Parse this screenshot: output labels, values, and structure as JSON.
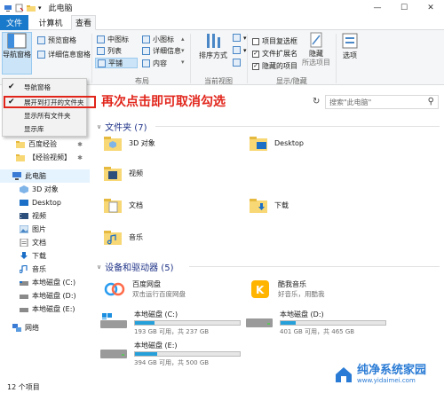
{
  "window": {
    "title": "此电脑"
  },
  "tabs": {
    "file": "文件",
    "computer": "计算机",
    "view": "查看"
  },
  "ribbon": {
    "nav_pane_button": "导航窗格",
    "preview_pane": "预览窗格",
    "details_pane": "详细信息窗格",
    "layout": {
      "medium_icons": "中图标",
      "small_icons": "小图标",
      "list": "列表",
      "details": "详细信息",
      "tiles": "平铺",
      "content": "内容"
    },
    "sort_by": "排序方式",
    "item_checkboxes": "项目复选框",
    "file_extensions": "文件扩展名",
    "hidden_items": "隐藏的项目",
    "hide_selected": "隐藏",
    "hide_selected_sub": "所选项目",
    "options": "选项",
    "groups": {
      "layout": "布局",
      "current_view": "当前视图",
      "show_hide": "显示/隐藏"
    }
  },
  "search": {
    "placeholder": "搜索\"此电脑\""
  },
  "dropdown": {
    "items": [
      {
        "label": "导航窗格",
        "checked": true
      },
      {
        "label": "展开到打开的文件夹",
        "checked": true
      },
      {
        "label": "显示所有文件夹",
        "checked": false
      },
      {
        "label": "显示库",
        "checked": false
      }
    ]
  },
  "annotation": "再次点击即可取消勾选",
  "nav": {
    "quick_items": [
      {
        "label": "百度经验",
        "icon": "folder-icon"
      },
      {
        "label": "【经验视频】",
        "icon": "folder-icon"
      }
    ],
    "this_pc": "此电脑",
    "items": [
      {
        "label": "3D 对象",
        "icon": "3d-objects-icon"
      },
      {
        "label": "Desktop",
        "icon": "desktop-icon"
      },
      {
        "label": "视频",
        "icon": "videos-icon"
      },
      {
        "label": "图片",
        "icon": "pictures-icon"
      },
      {
        "label": "文档",
        "icon": "documents-icon"
      },
      {
        "label": "下载",
        "icon": "downloads-icon"
      },
      {
        "label": "音乐",
        "icon": "music-icon"
      },
      {
        "label": "本地磁盘 (C:)",
        "icon": "drive-icon"
      },
      {
        "label": "本地磁盘 (D:)",
        "icon": "drive-icon"
      },
      {
        "label": "本地磁盘 (E:)",
        "icon": "drive-icon"
      }
    ],
    "network": "网络"
  },
  "content": {
    "folders_header": "文件夹 (7)",
    "folders": [
      {
        "label": "3D 对象",
        "icon": "3d-objects-icon"
      },
      {
        "label": "Desktop",
        "icon": "desktop-folder-icon"
      },
      {
        "label": "视频",
        "icon": "videos-folder-icon"
      },
      {
        "label": "图片",
        "icon": "pictures-folder-icon"
      },
      {
        "label": "文档",
        "icon": "documents-folder-icon"
      },
      {
        "label": "下载",
        "icon": "downloads-folder-icon"
      },
      {
        "label": "音乐",
        "icon": "music-folder-icon"
      }
    ],
    "devices_header": "设备和驱动器 (5)",
    "apps": [
      {
        "name": "百度网盘",
        "sub": "双击运行百度网盘",
        "icon": "baidu-netdisk-icon"
      },
      {
        "name": "酷我音乐",
        "sub": "好音乐，用酷我",
        "icon": "kuwo-music-icon"
      }
    ],
    "drives": [
      {
        "name": "本地磁盘 (C:)",
        "info": "193 GB 可用，共 237 GB",
        "used_fraction": 0.19
      },
      {
        "name": "本地磁盘 (D:)",
        "info": "401 GB 可用，共 465 GB",
        "used_fraction": 0.14
      },
      {
        "name": "本地磁盘 (E:)",
        "info": "394 GB 可用，共 500 GB",
        "used_fraction": 0.21
      }
    ]
  },
  "status": {
    "count": "12 个项目"
  },
  "watermark": {
    "title": "纯净系统家园",
    "url": "www.yidaimei.com"
  },
  "colors": {
    "accent": "#1979ca",
    "annotation": "#e1251b",
    "drive_bar": "#26a0da",
    "folder": "#f8d775"
  }
}
